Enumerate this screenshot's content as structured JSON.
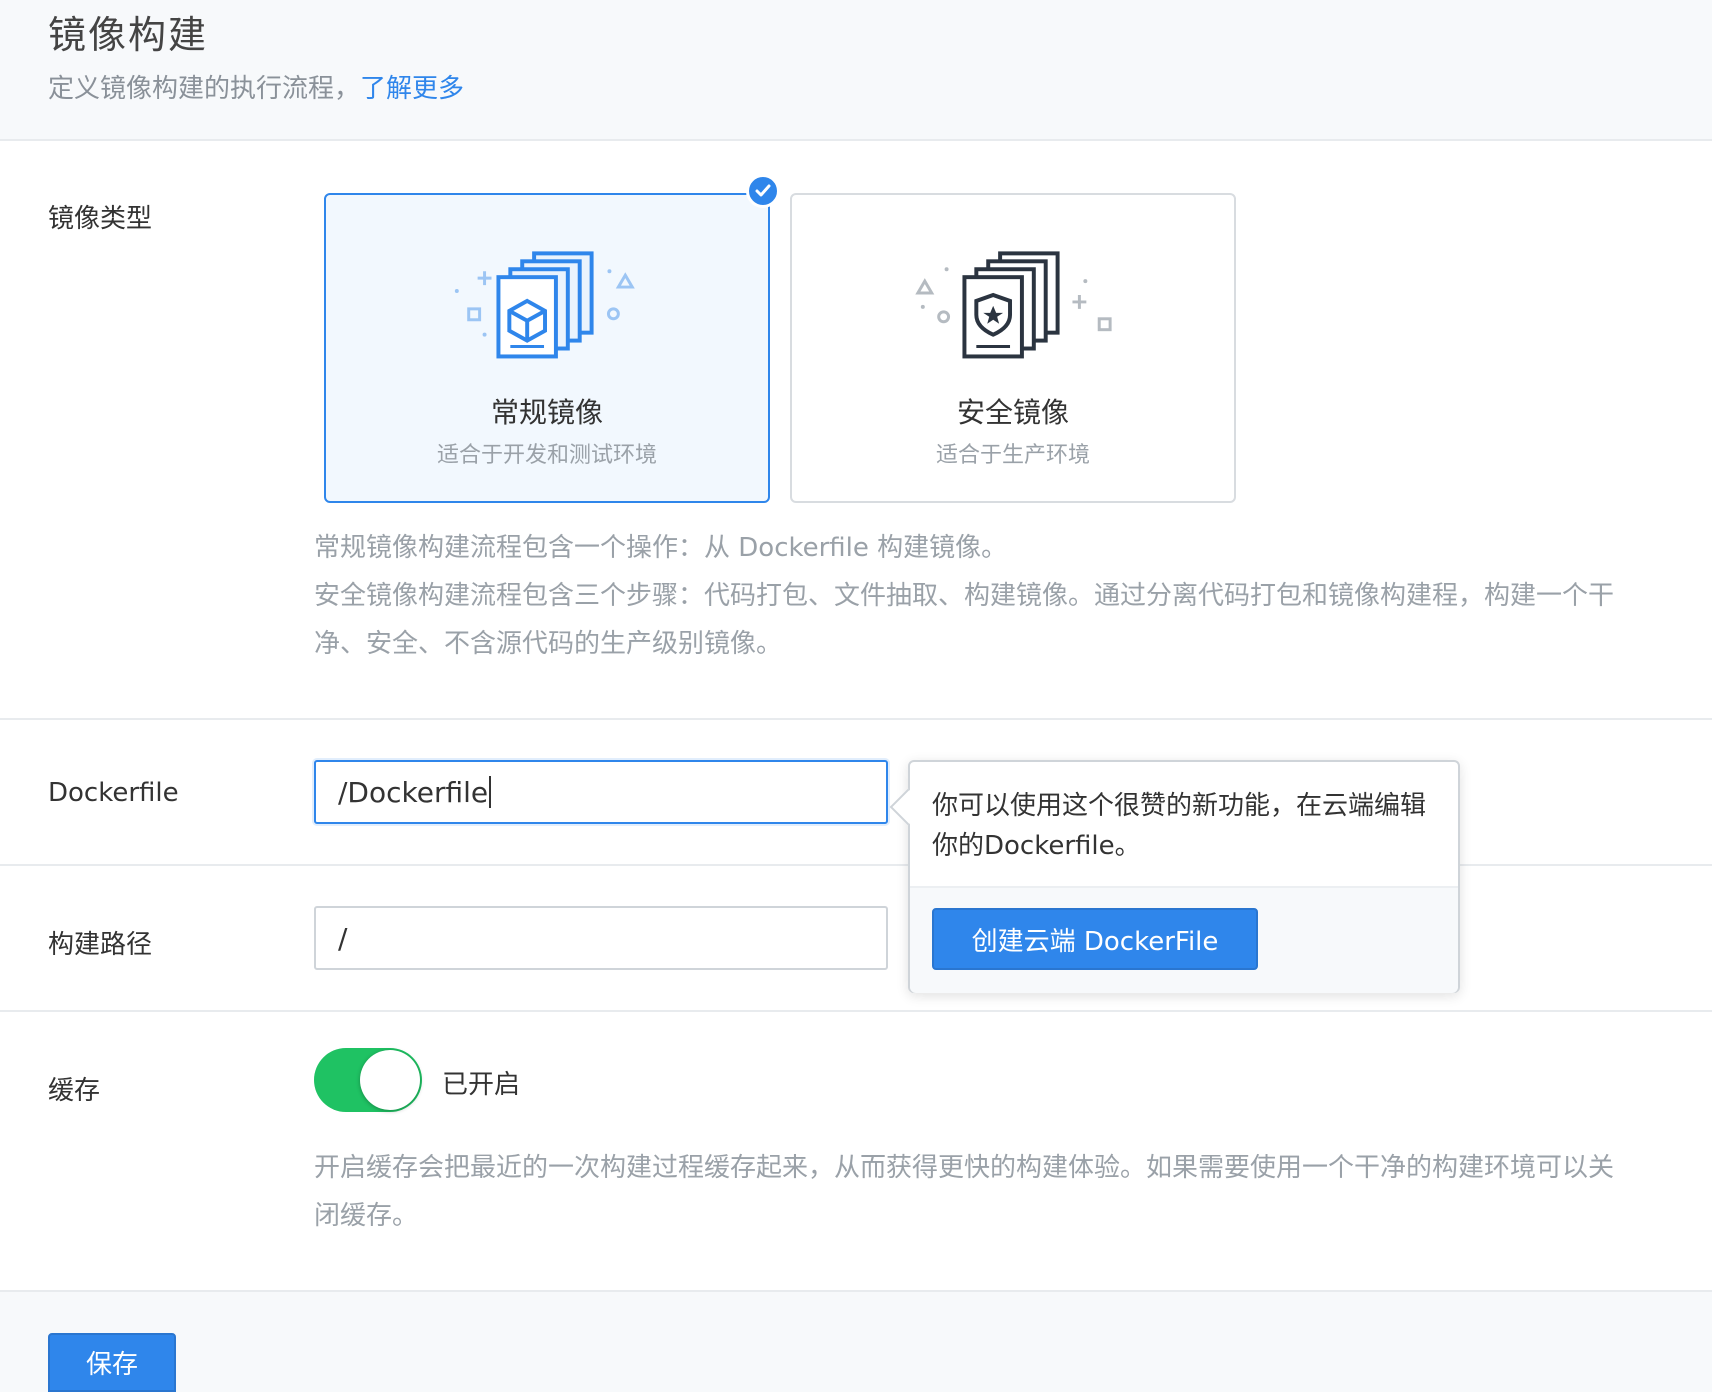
{
  "header": {
    "title": "镜像构建",
    "subtitle": "定义镜像构建的执行流程，",
    "learn_more": "了解更多"
  },
  "image_type": {
    "label": "镜像类型",
    "options": [
      {
        "name": "常规镜像",
        "desc": "适合于开发和测试环境",
        "selected": true,
        "icon": "box-document-stack-icon"
      },
      {
        "name": "安全镜像",
        "desc": "适合于生产环境",
        "selected": false,
        "icon": "shield-document-stack-icon"
      }
    ],
    "help_lines": [
      "常规镜像构建流程包含一个操作：从 Dockerfile 构建镜像。",
      "安全镜像构建流程包含三个步骤：代码打包、文件抽取、构建镜像。通过分离代码打包和镜像构建程，构建一个干",
      "净、安全、不含源代码的生产级别镜像。"
    ]
  },
  "dockerfile": {
    "label": "Dockerfile",
    "value": "/Dockerfile"
  },
  "popover": {
    "text": "你可以使用这个很赞的新功能，在云端编辑你的Dockerfile。",
    "button": "创建云端 DockerFile"
  },
  "build_path": {
    "label": "构建路径",
    "value": "/"
  },
  "cache": {
    "label": "缓存",
    "enabled": true,
    "status": "已开启",
    "help_lines": [
      "开启缓存会把最近的一次构建过程缓存起来，从而获得更快的构建体验。如果需要使用一个干净的构建环境可以关",
      "闭缓存。"
    ]
  },
  "actions": {
    "save": "保存"
  },
  "colors": {
    "accent": "#2f86eb",
    "toggle_on": "#1fc263"
  }
}
